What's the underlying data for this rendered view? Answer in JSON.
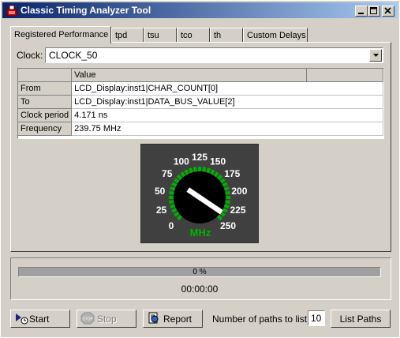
{
  "window": {
    "title": "Classic Timing Analyzer Tool",
    "minimize_icon": "minimize-icon",
    "maximize_icon": "maximize-icon",
    "close_icon": "close-icon"
  },
  "tabs": [
    {
      "label": "Registered Performance",
      "active": true
    },
    {
      "label": "tpd",
      "active": false
    },
    {
      "label": "tsu",
      "active": false
    },
    {
      "label": "tco",
      "active": false
    },
    {
      "label": "th",
      "active": false
    },
    {
      "label": "Custom Delays",
      "active": false
    }
  ],
  "clock": {
    "label": "Clock:",
    "value": "CLOCK_50"
  },
  "results": {
    "header": "Value",
    "rows": [
      {
        "label": "From",
        "value": "LCD_Display:inst1|CHAR_COUNT[0]"
      },
      {
        "label": "To",
        "value": "LCD_Display:inst1|DATA_BUS_VALUE[2]"
      },
      {
        "label": "Clock period",
        "value": "4.171 ns"
      },
      {
        "label": "Frequency",
        "value": "239.75 MHz"
      }
    ]
  },
  "gauge": {
    "ticks": [
      "0",
      "25",
      "50",
      "75",
      "100",
      "125",
      "150",
      "175",
      "200",
      "225",
      "250"
    ],
    "unit": "MHz",
    "value": 239.75,
    "min": 0,
    "max": 250,
    "accent_color": "#00b000"
  },
  "progress": {
    "percent_text": "0 %",
    "percent": 0,
    "elapsed": "00:00:00"
  },
  "buttons": {
    "start": "Start",
    "stop": "Stop",
    "report": "Report",
    "list_paths": "List Paths"
  },
  "paths": {
    "label": "Number of paths to list:",
    "value": "10"
  }
}
